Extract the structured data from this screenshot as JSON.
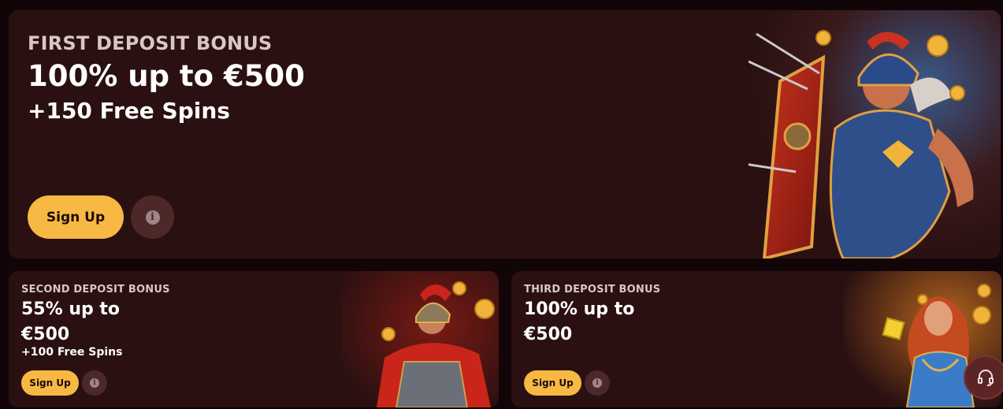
{
  "hero": {
    "eyebrow": "FIRST DEPOSIT BONUS",
    "headline": "100% up to €500",
    "subline": "+150 Free Spins",
    "signup_label": "Sign Up",
    "info_glyph": "i",
    "art_icon": "roman-gladiator-with-shield-icon"
  },
  "second": {
    "eyebrow": "SECOND DEPOSIT BONUS",
    "headline": "55% up to €500",
    "subline": "+100 Free Spins",
    "signup_label": "Sign Up",
    "info_glyph": "i",
    "art_icon": "roman-centurion-icon"
  },
  "third": {
    "eyebrow": "THIRD DEPOSIT BONUS",
    "headline": "100% up to €500",
    "signup_label": "Sign Up",
    "info_glyph": "i",
    "art_icon": "roman-goddess-icon"
  },
  "support": {
    "icon": "headset-icon"
  },
  "colors": {
    "page_bg": "#110507",
    "card_bg": "#2a1011",
    "accent_yellow": "#f7b844",
    "info_button_bg": "#4c2829"
  }
}
